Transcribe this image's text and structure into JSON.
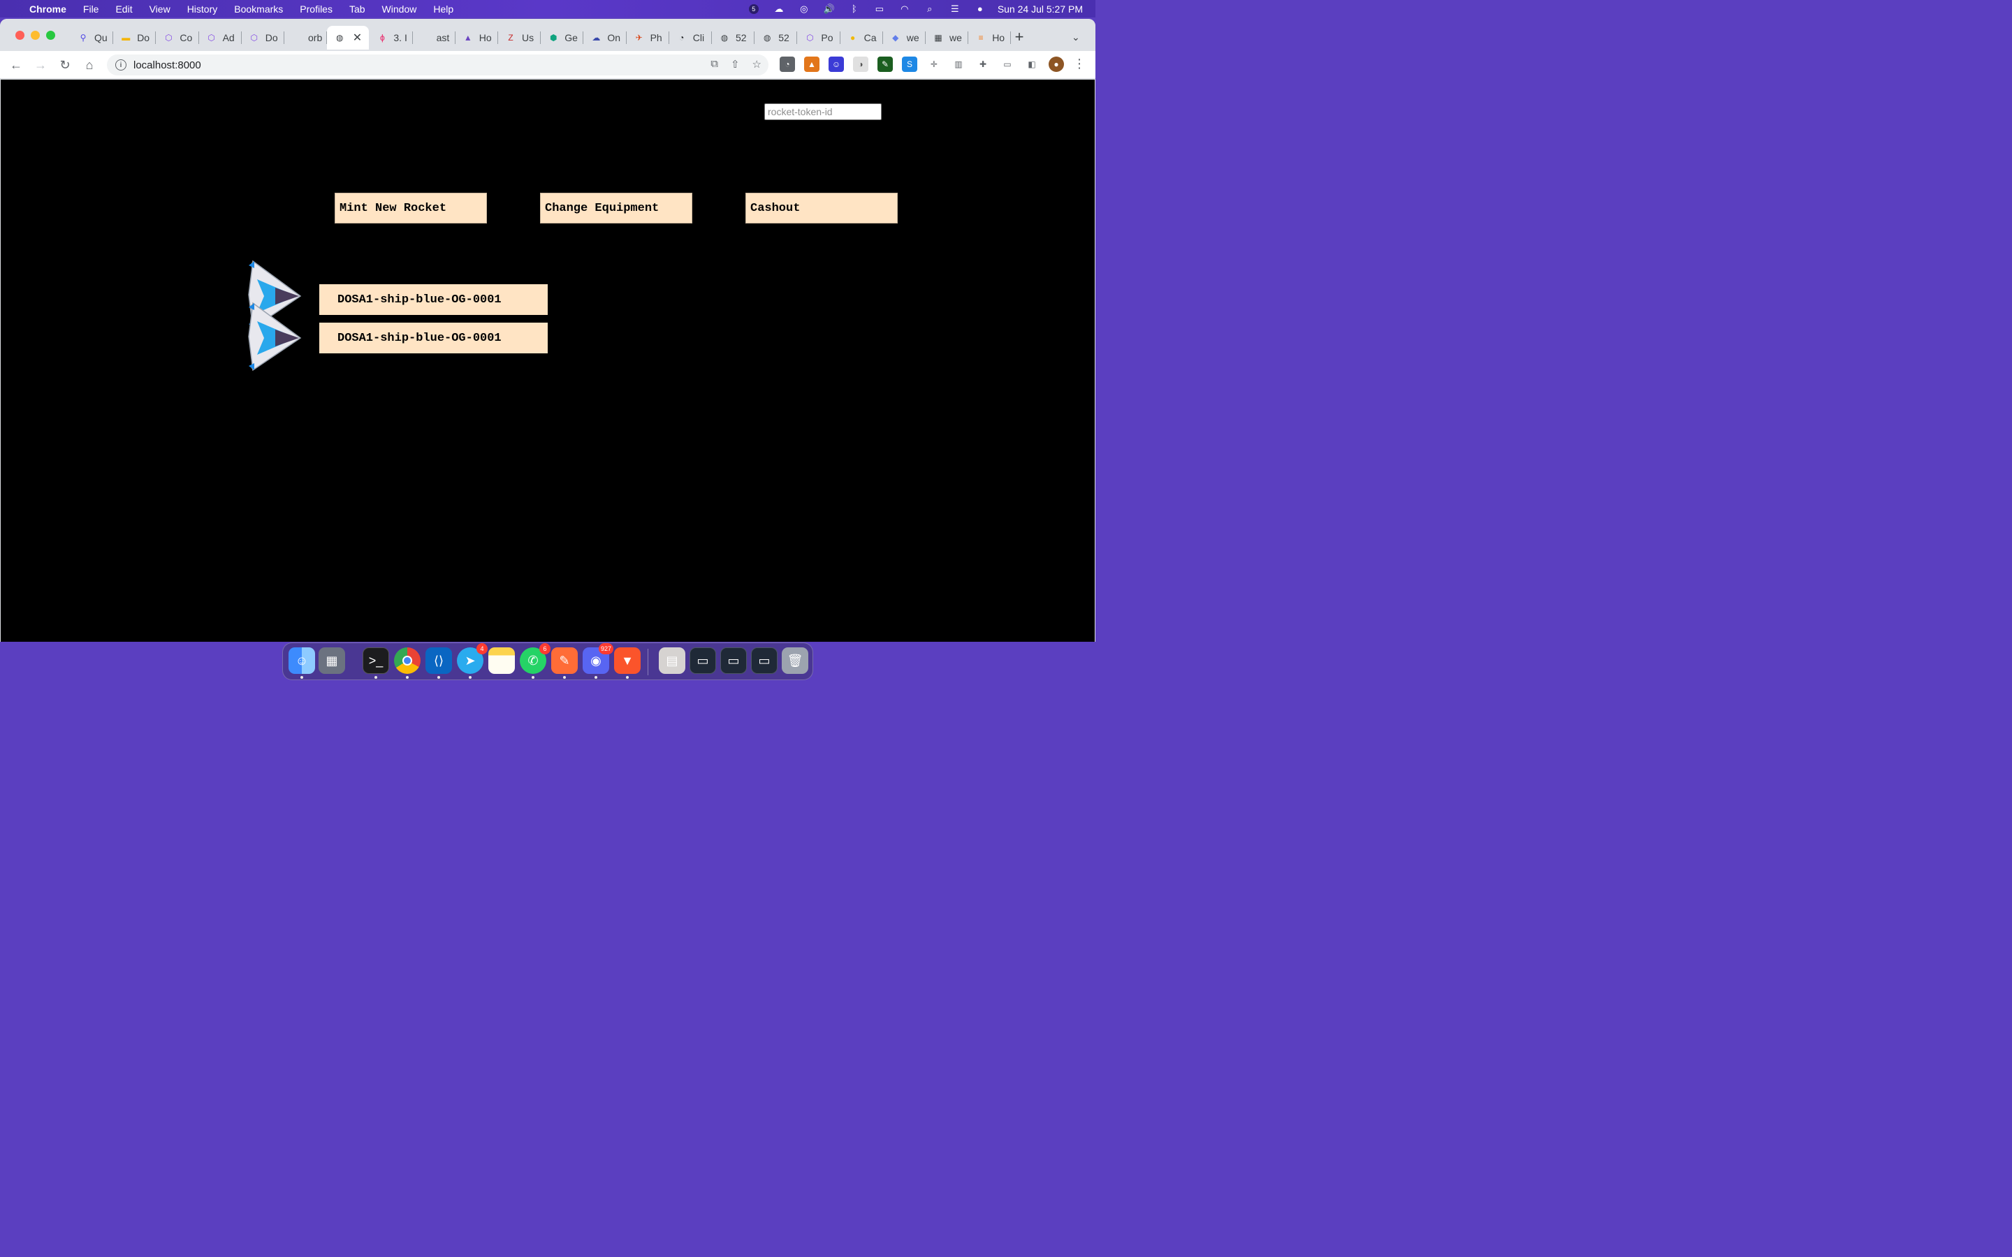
{
  "menubar": {
    "app": "Chrome",
    "items": [
      "File",
      "Edit",
      "View",
      "History",
      "Bookmarks",
      "Profiles",
      "Tab",
      "Window",
      "Help"
    ],
    "badge_count": "5",
    "clock": "Sun 24 Jul  5:27 PM"
  },
  "tabs": [
    {
      "label": "Qu",
      "icon": "search-icon",
      "color": "#4f46e5"
    },
    {
      "label": "Do",
      "icon": "slides-icon",
      "color": "#f4b400"
    },
    {
      "label": "Co",
      "icon": "polygon-icon",
      "color": "#8247e5"
    },
    {
      "label": "Ad",
      "icon": "polygon-icon",
      "color": "#8247e5"
    },
    {
      "label": "Do",
      "icon": "polygon-icon",
      "color": "#8247e5"
    },
    {
      "label": "orb",
      "icon": "blank-icon",
      "color": "#ffffff"
    },
    {
      "label": "",
      "icon": "globe-icon",
      "color": "#3c4043",
      "active": true
    },
    {
      "label": "3. I",
      "icon": "phi-icon",
      "color": "#e91e63"
    },
    {
      "label": "ast",
      "icon": "blank-icon",
      "color": "#ffffff"
    },
    {
      "label": "Ho",
      "icon": "rocket-icon",
      "color": "#6b46c1"
    },
    {
      "label": "Us",
      "icon": "z-icon",
      "color": "#c62828"
    },
    {
      "label": "Ge",
      "icon": "hexagon-icon",
      "color": "#10a37f"
    },
    {
      "label": "On",
      "icon": "cloud-icon",
      "color": "#3949ab"
    },
    {
      "label": "Ph",
      "icon": "plane-icon",
      "color": "#d84315"
    },
    {
      "label": "Cli",
      "icon": "compass-icon",
      "color": "#202124"
    },
    {
      "label": "52",
      "icon": "globe-icon",
      "color": "#3c4043"
    },
    {
      "label": "52",
      "icon": "globe-icon",
      "color": "#3c4043"
    },
    {
      "label": "Po",
      "icon": "polygon-icon",
      "color": "#8247e5"
    },
    {
      "label": "Ca",
      "icon": "coin-icon",
      "color": "#f0b90b"
    },
    {
      "label": "we",
      "icon": "ethereum-icon",
      "color": "#627eea"
    },
    {
      "label": "we",
      "icon": "docs-icon",
      "color": "#3c4043"
    },
    {
      "label": "Ho",
      "icon": "stackoverflow-icon",
      "color": "#f48024"
    }
  ],
  "address_bar": {
    "url": "localhost:8000"
  },
  "page": {
    "token_input_placeholder": "rocket-token-id",
    "buttons": {
      "mint": "Mint New Rocket",
      "change": "Change Equipment",
      "cashout": "Cashout"
    },
    "ships": [
      {
        "label": "DOSA1-ship-blue-OG-0001"
      },
      {
        "label": "DOSA1-ship-blue-OG-0001"
      }
    ]
  },
  "dock": {
    "telegram_badge": "4",
    "whatsapp_badge": "6",
    "discord_badge": "927"
  }
}
